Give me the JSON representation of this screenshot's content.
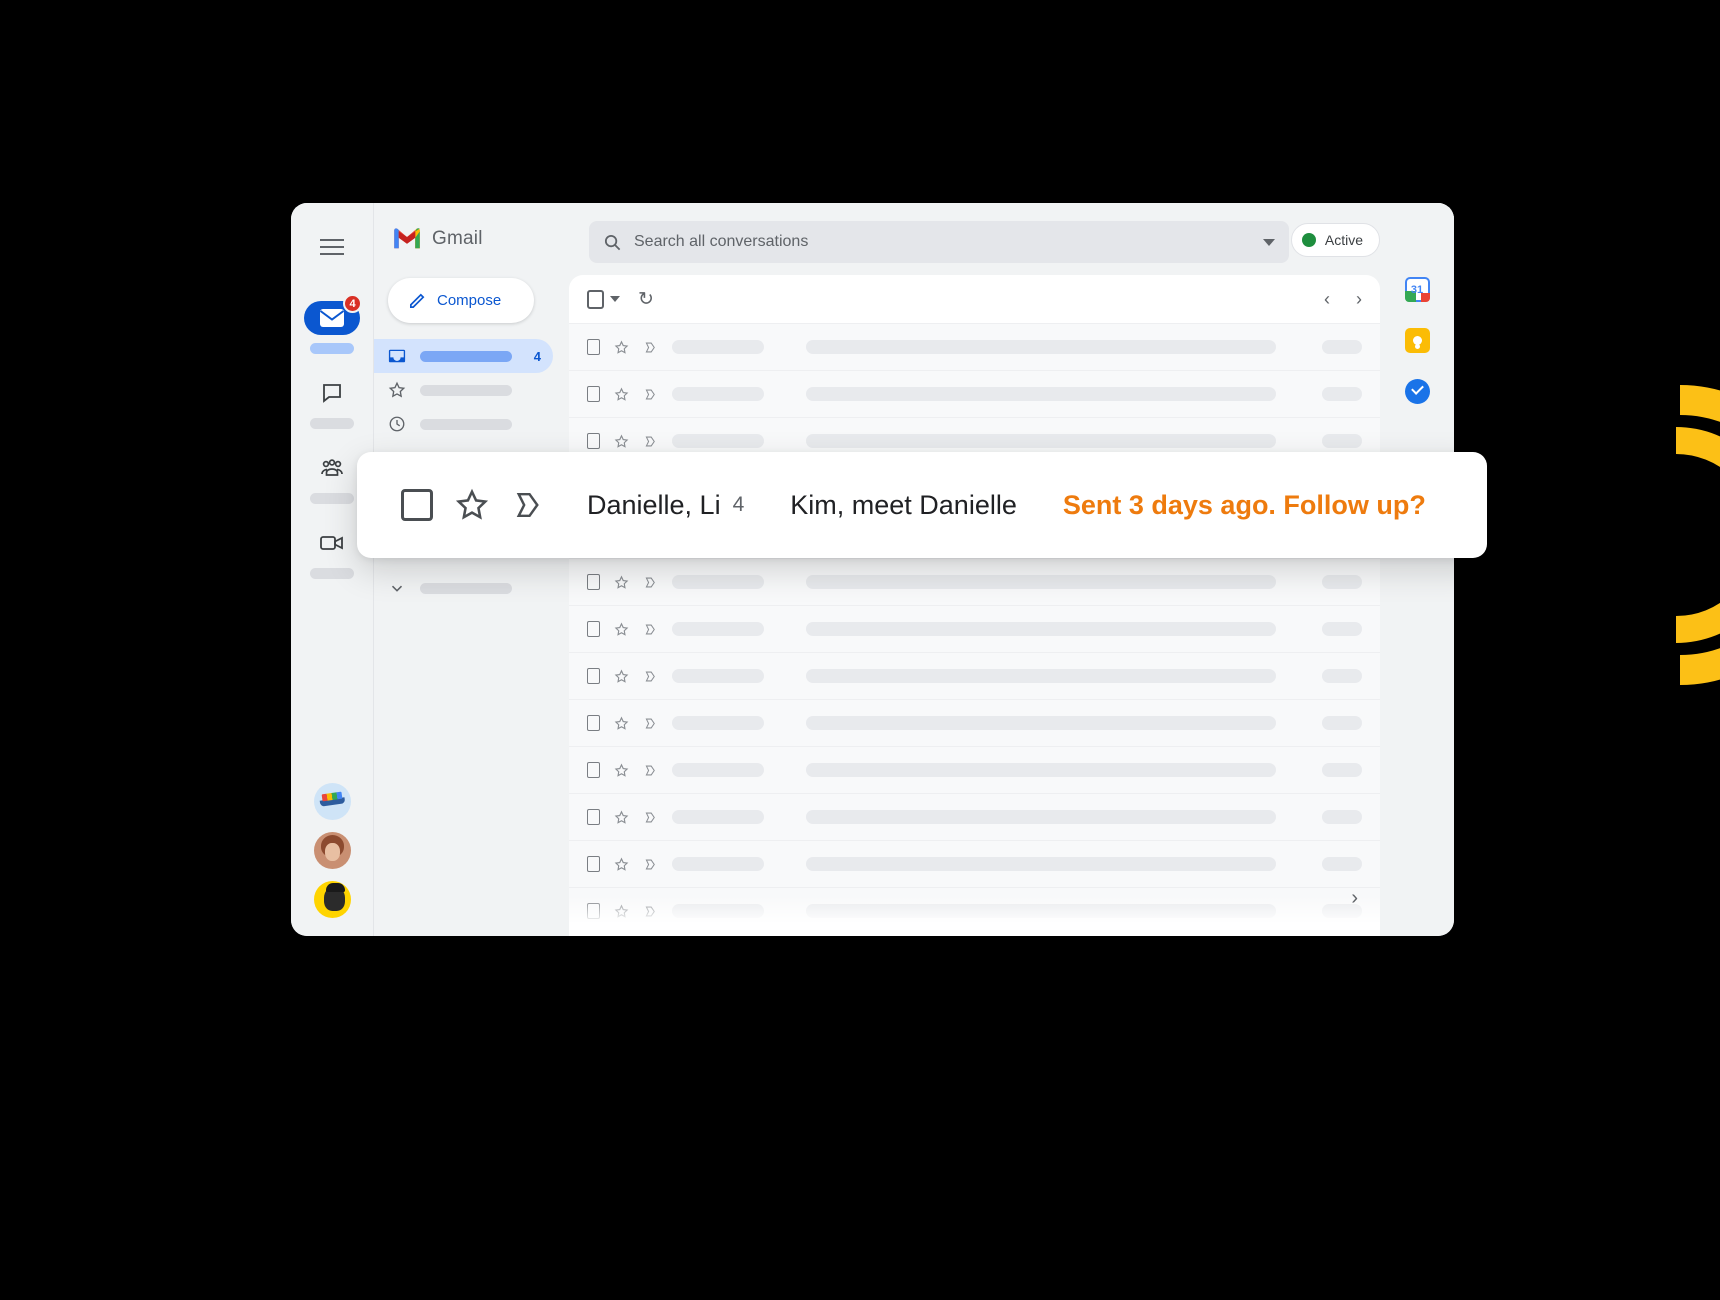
{
  "theme": {
    "accent_orange": "#EE7B0E",
    "gmail_blue": "#0B57D0",
    "arc_yellow": "#FCC016",
    "active_green": "#1E8E3E",
    "badge_red": "#D93025"
  },
  "app": {
    "brand_name": "Gmail",
    "menu_icon": "hamburger-icon"
  },
  "search": {
    "placeholder": "Search all conversations",
    "icon": "search-icon",
    "options_icon": "chevron-down-icon"
  },
  "presence": {
    "label": "Active",
    "status_icon": "green-dot-icon"
  },
  "left_rail": {
    "items": [
      {
        "name": "mail",
        "icon": "mail-icon",
        "badge": "4",
        "active": true
      },
      {
        "name": "chat",
        "icon": "chat-bubble-icon",
        "badge": "",
        "active": false
      },
      {
        "name": "spaces",
        "icon": "spaces-people-icon",
        "badge": "",
        "active": false
      },
      {
        "name": "meet",
        "icon": "video-camera-icon",
        "badge": "",
        "active": false
      }
    ],
    "avatars": [
      {
        "name": "cargo-ship-avatar"
      },
      {
        "name": "woman-portrait-avatar"
      },
      {
        "name": "yellow-portrait-avatar"
      }
    ]
  },
  "compose": {
    "label": "Compose",
    "icon": "pencil-icon"
  },
  "folders": [
    {
      "name": "inbox",
      "icon": "inbox-icon",
      "count": "4",
      "selected": true
    },
    {
      "name": "starred",
      "icon": "star-icon",
      "count": "",
      "selected": false
    },
    {
      "name": "snoozed",
      "icon": "clock-icon",
      "count": "",
      "selected": false
    },
    {
      "name": "more",
      "icon": "chevron-down-icon",
      "count": "",
      "selected": false
    }
  ],
  "list_toolbar": {
    "select_all_icon": "checkbox-icon",
    "select_dropdown_icon": "caret-down-icon",
    "refresh_icon": "refresh-icon",
    "prev_icon": "chevron-left-icon",
    "next_icon": "chevron-right-icon"
  },
  "email_rows": [
    {
      "id": 1
    },
    {
      "id": 2
    },
    {
      "id": 3
    },
    {
      "id": 4
    },
    {
      "id": 5
    },
    {
      "id": 6
    },
    {
      "id": 7
    },
    {
      "id": 8
    },
    {
      "id": 9
    },
    {
      "id": 10
    },
    {
      "id": 11
    },
    {
      "id": 12
    },
    {
      "id": 13
    }
  ],
  "callout": {
    "checkbox_icon": "checkbox-icon",
    "star_icon": "star-outline-icon",
    "important_icon": "important-marker-icon",
    "sender": "Danielle, Li",
    "message_count": "4",
    "subject": "Kim, meet Danielle",
    "note": "Sent 3 days ago. Follow up?"
  },
  "right_rail": {
    "apps": [
      {
        "name": "google-calendar",
        "icon": "calendar-icon",
        "label": "31"
      },
      {
        "name": "google-keep",
        "icon": "lightbulb-icon",
        "label": ""
      },
      {
        "name": "google-tasks",
        "icon": "check-circle-icon",
        "label": ""
      }
    ]
  },
  "misc": {
    "scroll_next_icon": "chevron-right-icon"
  }
}
